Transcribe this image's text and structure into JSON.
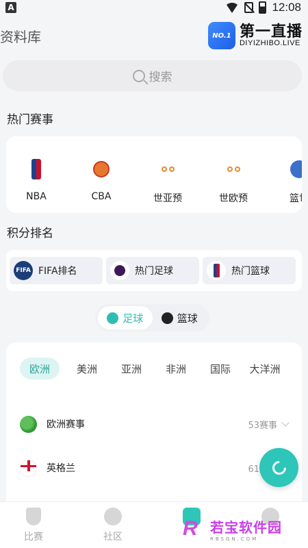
{
  "status_bar": {
    "time": "12:08",
    "left_icon": "A"
  },
  "header": {
    "title": "资料库",
    "brand_badge": "NO.1",
    "brand_name": "第一直播",
    "brand_url": "DIYIZHIBO.LIVE"
  },
  "search": {
    "placeholder": "搜索"
  },
  "hot_section": {
    "title": "热门赛事",
    "items": [
      {
        "label": "NBA",
        "icon": "nba-logo-icon"
      },
      {
        "label": "CBA",
        "icon": "cba-logo-icon"
      },
      {
        "label": "世亚预",
        "icon": "fiba-asia-qualifier-icon"
      },
      {
        "label": "世欧预",
        "icon": "fiba-europe-qualifier-icon"
      },
      {
        "label": "篮世",
        "icon": "basketball-world-cup-icon"
      }
    ]
  },
  "rank_section": {
    "title": "积分排名",
    "items": [
      {
        "label": "FIFA排名",
        "icon": "fifa-logo-icon",
        "badge": "FIFA"
      },
      {
        "label": "热门足球",
        "icon": "premier-league-icon"
      },
      {
        "label": "热门篮球",
        "icon": "nba-logo-icon"
      }
    ]
  },
  "sport_toggle": {
    "options": [
      {
        "label": "足球",
        "icon": "soccer-ball-icon",
        "active": true
      },
      {
        "label": "篮球",
        "icon": "basketball-icon",
        "active": false
      }
    ]
  },
  "region_tabs": [
    "欧洲",
    "美洲",
    "亚洲",
    "非洲",
    "国际",
    "大洋洲"
  ],
  "region_active": "欧洲",
  "list": [
    {
      "name": "欧洲赛事",
      "count": "53赛事",
      "icon": "globe-icon"
    },
    {
      "name": "英格兰",
      "count": "61赛事",
      "icon": "england-flag-icon"
    }
  ],
  "tabbar": {
    "items": [
      {
        "label": "比赛",
        "icon": "trophy-icon"
      },
      {
        "label": "社区",
        "icon": "compass-icon"
      },
      {
        "label": "资料库",
        "icon": "database-icon"
      },
      {
        "label": "我的",
        "icon": "profile-icon"
      }
    ]
  },
  "watermark": {
    "logo": "R",
    "cn": "若宝软件园",
    "en": "RBSGN.COM"
  },
  "colors": {
    "accent": "#2dc6b8",
    "accent_text": "#2aa59d",
    "tab_active_bg": "#ddf4f2",
    "page_bg": "#f4f5f7"
  }
}
